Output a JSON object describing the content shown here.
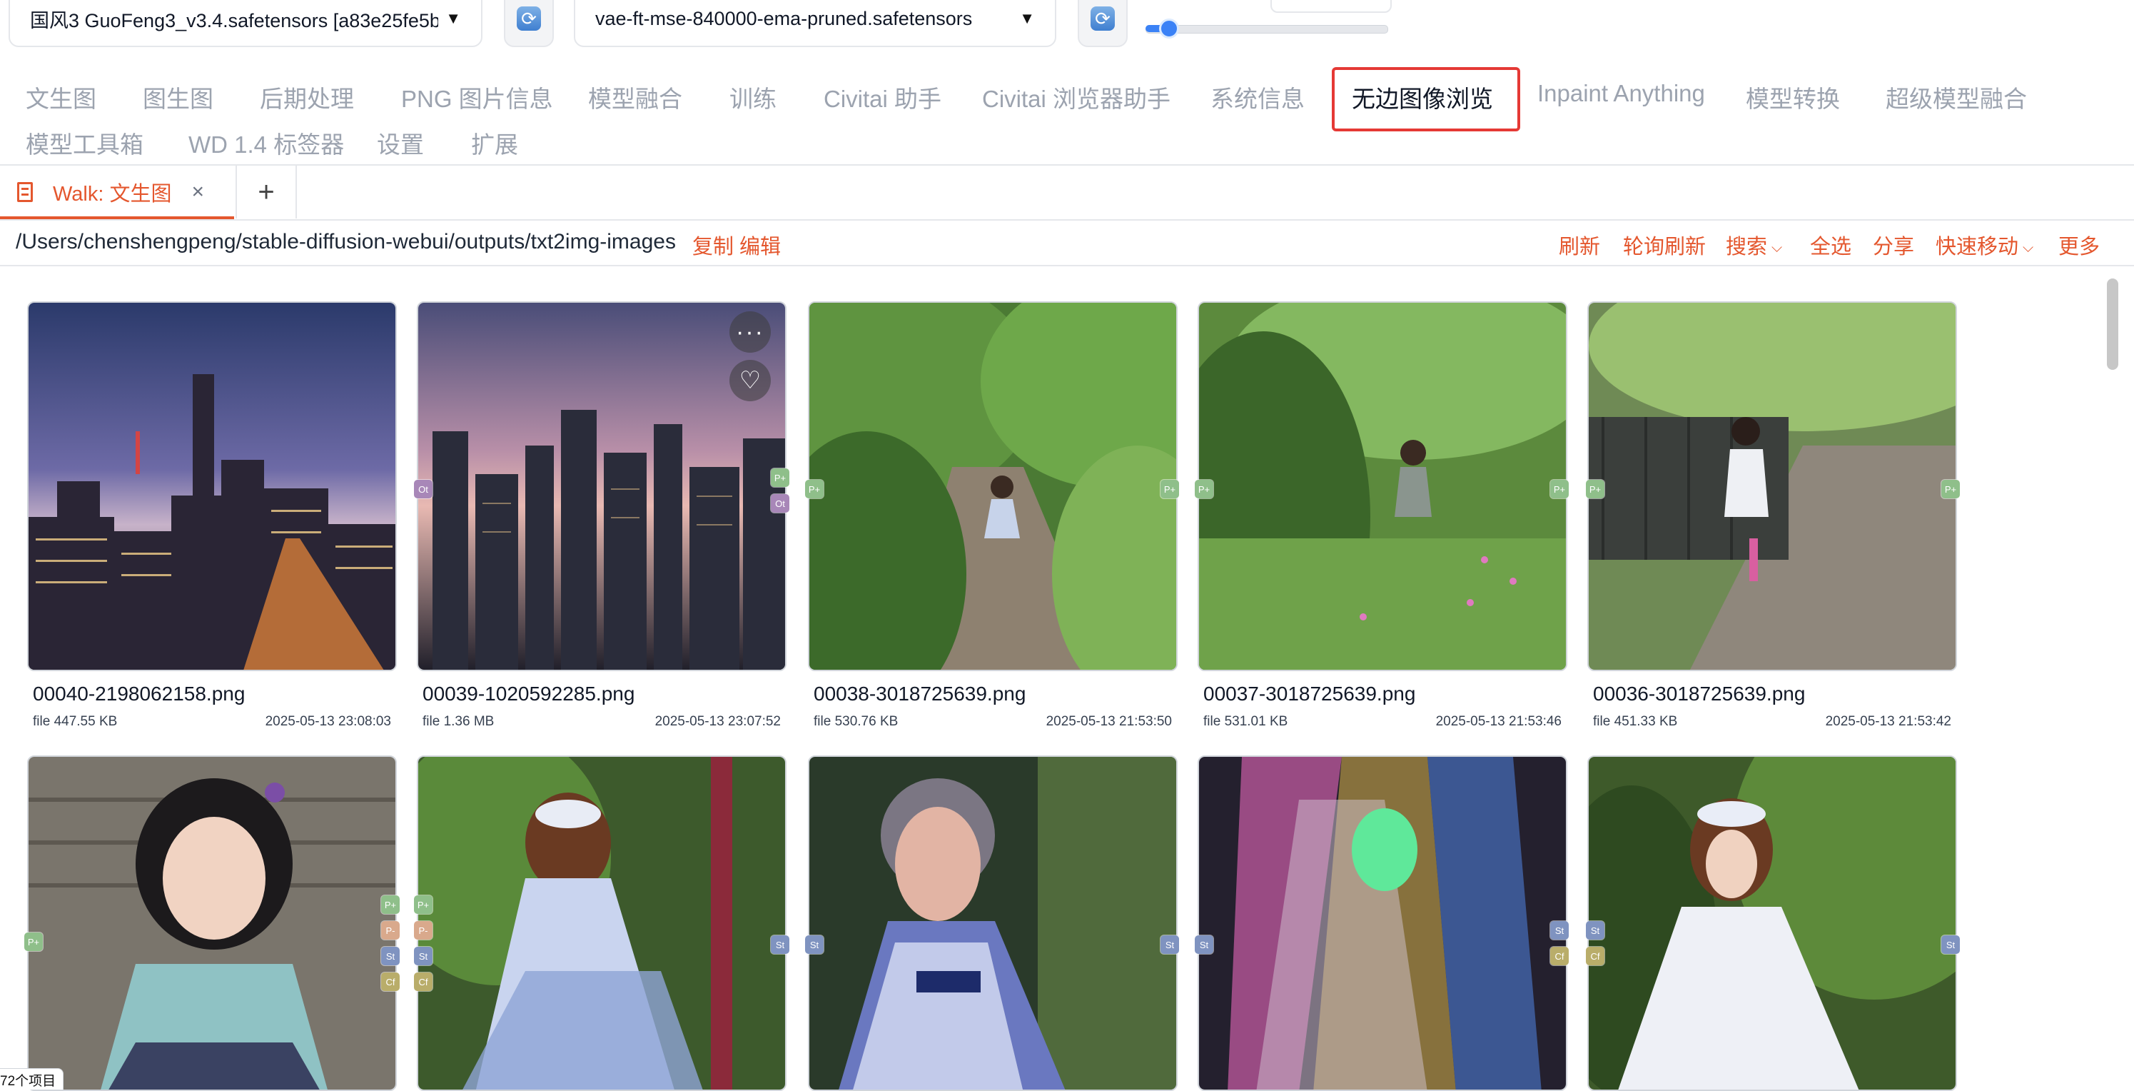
{
  "top": {
    "model_select": "国风3 GuoFeng3_v3.4.safetensors [a83e25fe5b]",
    "vae_select": "vae-ft-mse-840000-ema-pruned.safetensors",
    "refresh_icon": "refresh-icon",
    "clip_skip_value": "2",
    "clip_skip_fraction": 0.06
  },
  "tabs": [
    "文生图",
    "图生图",
    "后期处理",
    "PNG 图片信息",
    "模型融合",
    "训练",
    "Civitai 助手",
    "Civitai 浏览器助手",
    "系统信息",
    "无边图像浏览",
    "Inpaint Anything",
    "模型转换",
    "超级模型融合",
    "模型工具箱",
    "WD 1.4 标签器",
    "设置",
    "扩展"
  ],
  "active_tab": "无边图像浏览",
  "walk_tab": {
    "label": "Walk: 文生图",
    "close": "×",
    "add": "+"
  },
  "path_bar": {
    "path": "/Users/chenshengpeng/stable-diffusion-webui/outputs/txt2img-images",
    "copy": "复制",
    "edit": "编辑",
    "actions": {
      "refresh": "刷新",
      "poll_refresh": "轮询刷新",
      "search": "搜索",
      "select_all": "全选",
      "share": "分享",
      "quick_move": "快速移动",
      "more": "更多"
    }
  },
  "images": [
    {
      "name": "00040-2198062158.png",
      "size": "file 447.55 KB",
      "date": "2025-05-13 23:08:03"
    },
    {
      "name": "00039-1020592285.png",
      "size": "file 1.36 MB",
      "date": "2025-05-13 23:07:52"
    },
    {
      "name": "00038-3018725639.png",
      "size": "file 530.76 KB",
      "date": "2025-05-13 21:53:50"
    },
    {
      "name": "00037-3018725639.png",
      "size": "file 531.01 KB",
      "date": "2025-05-13 21:53:46"
    },
    {
      "name": "00036-3018725639.png",
      "size": "file 451.33 KB",
      "date": "2025-05-13 21:53:42"
    }
  ],
  "card_actions": {
    "more": "···",
    "favorite": "♡"
  },
  "badges": {
    "p_plus": "P+",
    "p_minus": "P-",
    "ot": "Ot",
    "st": "St",
    "cf": "Cf"
  },
  "count_label": "72个项目",
  "accent_color": "#e4572e"
}
